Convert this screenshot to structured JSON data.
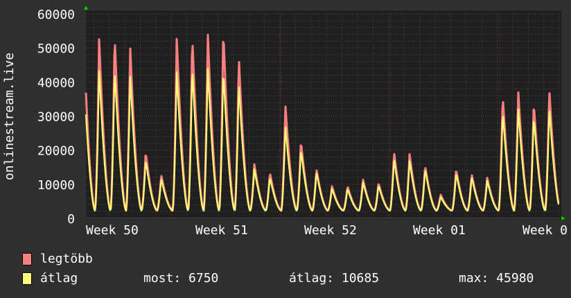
{
  "chart_data": {
    "type": "line",
    "ylabel": "onlinestream.live",
    "ylim": [
      0,
      60000
    ],
    "yticks": [
      "0",
      "10000",
      "20000",
      "30000",
      "40000",
      "50000",
      "60000"
    ],
    "xticks": [
      "Week 50",
      "Week 51",
      "Week 52",
      "Week 01",
      "Week 0"
    ],
    "x_unit": "day",
    "grid": true,
    "trough": 2300,
    "series": [
      {
        "name": "legtöbb",
        "color": "#ff7f7f",
        "daily_peaks": [
          53100,
          53700,
          50600,
          19500,
          12800,
          53200,
          53500,
          54700,
          55200,
          47500,
          16000,
          13500,
          33300,
          22700,
          14500,
          9500,
          9500,
          11500,
          10500,
          19500,
          19000,
          15500,
          7000,
          14500,
          13000,
          12000,
          36000,
          37500,
          34000,
          38000
        ]
      },
      {
        "name": "átlag",
        "color": "#ffff77",
        "daily_peaks": [
          45100,
          45500,
          43500,
          17800,
          12000,
          44700,
          46000,
          45980,
          45100,
          41000,
          15000,
          12500,
          28000,
          21000,
          14000,
          9000,
          9000,
          11000,
          10000,
          18000,
          17500,
          15000,
          6500,
          13800,
          12500,
          11500,
          32500,
          33500,
          31000,
          33500
        ]
      }
    ]
  },
  "legend": {
    "max_label": "legtöbb",
    "avg_label": "átlag",
    "current": "most: 6750",
    "average": "átlag: 10685",
    "maximum": "max: 45980"
  },
  "colors": {
    "background": "#2f2f2f",
    "plot": "#1f1f1f",
    "grid_major": "#7a3a3a",
    "grid_minor": "#4a4a4a",
    "axis_arrow": "#00cc00"
  }
}
